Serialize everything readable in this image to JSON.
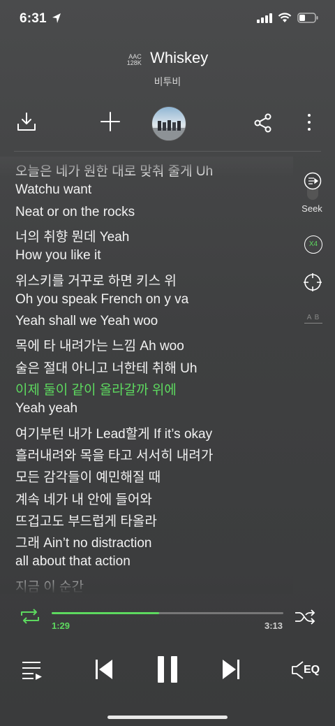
{
  "status_bar": {
    "time": "6:31"
  },
  "header": {
    "codec_format": "AAC",
    "codec_bitrate": "128K",
    "title": "Whiskey",
    "artist": "비투비"
  },
  "toolbar": {
    "download": "download-icon",
    "add": "plus-icon",
    "share": "share-icon",
    "more": "more-icon"
  },
  "lyrics": [
    "오늘은 네가 원한 대로 맞춰 줄게 Uh",
    "Watchu want",
    "Neat or on the rocks",
    "너의 취향 뭔데 Yeah",
    "How you like it",
    "위스키를 거꾸로 하면 키스 위",
    "Oh you speak French on y va",
    "Yeah shall we Yeah woo",
    "목에 타 내려가는 느낌 Ah woo",
    "술은 절대 아니고 너한테 취해 Uh",
    "이제 둘이 같이 올라갈까 위에",
    "Yeah yeah",
    "여기부턴 내가 Lead할게 If it’s okay",
    "흘러내려와 목을 타고 서서히 내려가",
    "모든 감각들이 예민해질 때",
    "계속 네가 내 안에 들어와",
    "뜨겁고도 부드럽게 타올라",
    "그래 Ain’t no distraction",
    "all about that action",
    "지금 이 순간"
  ],
  "active_lyric_index": 10,
  "side_controls": {
    "seek_label": "Seek",
    "speed_label": "X4",
    "ab_label": "A B"
  },
  "playback": {
    "current_time": "1:29",
    "total_time": "3:13",
    "progress": 0.465
  },
  "colors": {
    "accent": "#5dd95f"
  },
  "controls": {
    "eq_label": "EQ",
    "repeat": "repeat-icon",
    "shuffle": "shuffle-icon",
    "playlist": "playlist-icon",
    "prev": "previous-icon",
    "pause": "pause-icon",
    "next": "next-icon"
  }
}
